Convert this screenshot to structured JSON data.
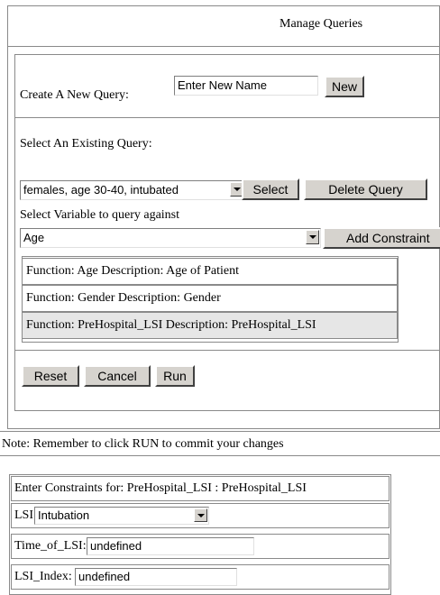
{
  "header": {
    "title": "Manage Queries"
  },
  "create_query": {
    "label": "Create A New Query:",
    "name_input_value": "Enter New Name",
    "new_button": "New"
  },
  "existing_query": {
    "label": "Select An Existing Query:",
    "selected_query": "females, age 30-40, intubated",
    "select_button": "Select",
    "delete_button": "Delete Query"
  },
  "variable": {
    "label": "Select Variable to query against",
    "selected_variable": "Age",
    "add_constraint_button": "Add Constraint"
  },
  "constraints_list": [
    "Function: Age Description: Age of Patient",
    "Function: Gender Description: Gender",
    "Function: PreHospital_LSI Description: PreHospital_LSI"
  ],
  "actions": {
    "reset_button": "Reset",
    "cancel_button": "Cancel",
    "run_button": "Run"
  },
  "note": "Note: Remember to click RUN to commit your changes",
  "constraint_editor": {
    "heading": "Enter Constraints for: PreHospital_LSI : PreHospital_LSI",
    "lsi_label": "LSI:",
    "lsi_value": "Intubation",
    "time_label": "Time_of_LSI:",
    "time_value": "undefined",
    "index_label": "LSI_Index:",
    "index_value": "undefined"
  }
}
